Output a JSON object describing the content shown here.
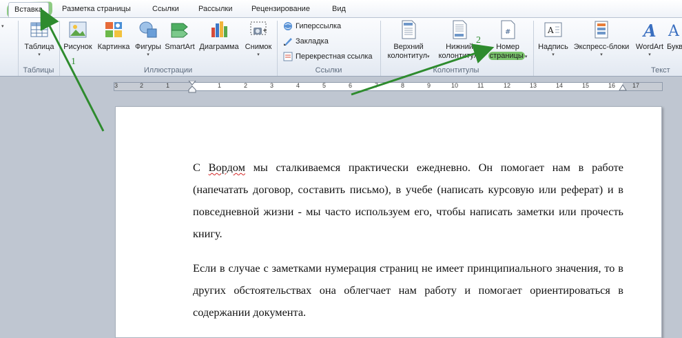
{
  "tabs": [
    {
      "label": "Вставка",
      "active": true
    },
    {
      "label": "Разметка страницы"
    },
    {
      "label": "Ссылки"
    },
    {
      "label": "Рассылки"
    },
    {
      "label": "Рецензирование"
    },
    {
      "label": "Вид"
    }
  ],
  "ribbon": {
    "groups": {
      "tables": "Таблицы",
      "illustrations": "Иллюстрации",
      "links": "Ссылки",
      "headers": "Колонтитулы",
      "text": "Текст"
    },
    "buttons": {
      "table": "Таблица",
      "picture": "Рисунок",
      "clipart": "Картинка",
      "shapes": "Фигуры",
      "smartart": "SmartArt",
      "chart": "Диаграмма",
      "screenshot": "Снимок",
      "hyperlink": "Гиперссылка",
      "bookmark": "Закладка",
      "crossref": "Перекрестная ссылка",
      "header_l1": "Верхний",
      "header_l2": "колонтитул",
      "footer_l1": "Нижний",
      "footer_l2": "колонтитул",
      "pagenum_l1": "Номер",
      "pagenum_l2": "страницы",
      "textbox": "Надпись",
      "quickparts": "Экспресс-блоки",
      "wordart": "WordArt",
      "dropcap": "Букв"
    },
    "caret": "▾"
  },
  "ruler": {
    "labels": [
      "3",
      "2",
      "1",
      "1",
      "1",
      "2",
      "3",
      "4",
      "5",
      "6",
      "7",
      "8",
      "9",
      "10",
      "11",
      "12",
      "13",
      "14",
      "15",
      "16",
      "17"
    ]
  },
  "document": {
    "p1_word1": "С",
    "p1_word2": "Вордом",
    "p1_rest": " мы сталкиваемся практически ежедневно. Он помогает нам в работе (напечатать договор, составить письмо), в учебе (написать курсовую или реферат) и в повседневной жизни - мы часто используем его, чтобы написать заметки или прочесть книгу.",
    "p2": "Если в случае с заметками нумерация страниц не имеет принципиального значения, то в других обстоятельствах она облегчает нам работу и помогает ориентироваться в содержании документа."
  },
  "annotations": {
    "step1": "1",
    "step2": "2"
  },
  "colors": {
    "annotation": "#2e8b2e",
    "highlight": "#79c26b",
    "ribbon_bg": "#eef2f8",
    "workspace": "#bfc6d1"
  }
}
